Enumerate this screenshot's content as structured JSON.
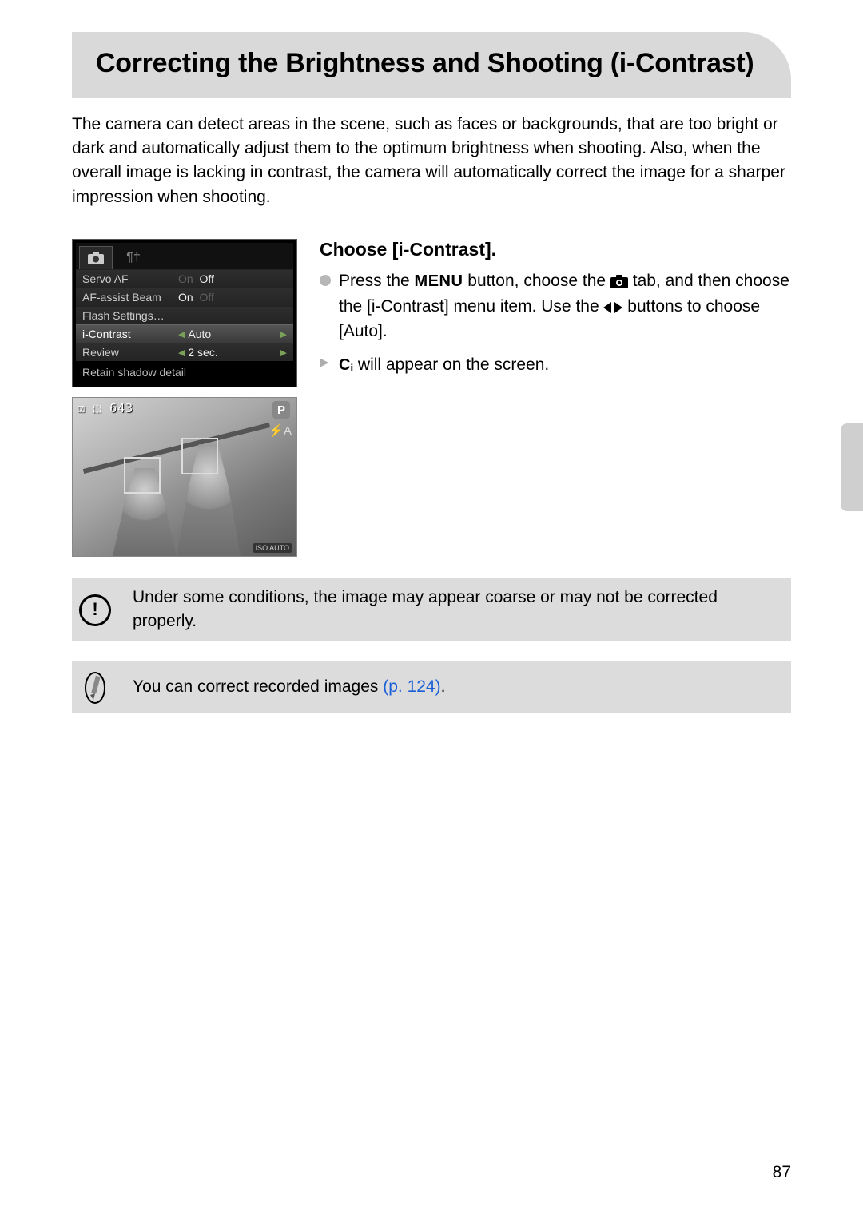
{
  "title": "Correcting the Brightness and Shooting (i-Contrast)",
  "intro": "The camera can detect areas in the scene, such as faces or backgrounds, that are too bright or dark and automatically adjust them to the optimum brightness when shooting. Also, when the overall image is lacking in contrast, the camera will automatically correct the image for a sharper impression when shooting.",
  "menu": {
    "rows": [
      {
        "label": "Servo AF",
        "dim": "On",
        "on": "Off"
      },
      {
        "label": "AF-assist Beam",
        "on": "On",
        "dim": "Off"
      },
      {
        "label": "Flash Settings…",
        "on": "",
        "dim": ""
      },
      {
        "label": "i-Contrast",
        "val": "Auto",
        "selected": true
      },
      {
        "label": "Review",
        "val": "2 sec."
      }
    ],
    "footer": "Retain shadow detail"
  },
  "photo_overlay": {
    "top": "☑ ⬚ 643",
    "mode": "P",
    "flash": "⚡A",
    "iso": "ISO AUTO"
  },
  "step": {
    "heading": "Choose [i-Contrast].",
    "line1a": "Press the ",
    "menu_word": "MENU",
    "line1b": " button, choose the ",
    "line1c": " tab, and then choose the [i-Contrast] menu item. Use the ",
    "line1d": " buttons to choose [Auto].",
    "line2a": " will appear on the screen."
  },
  "notes": {
    "warn": "Under some conditions, the image may appear coarse or may not be corrected properly.",
    "tip_a": "You can correct recorded images ",
    "tip_link": "(p. 124)",
    "tip_b": "."
  },
  "page_number": "87"
}
